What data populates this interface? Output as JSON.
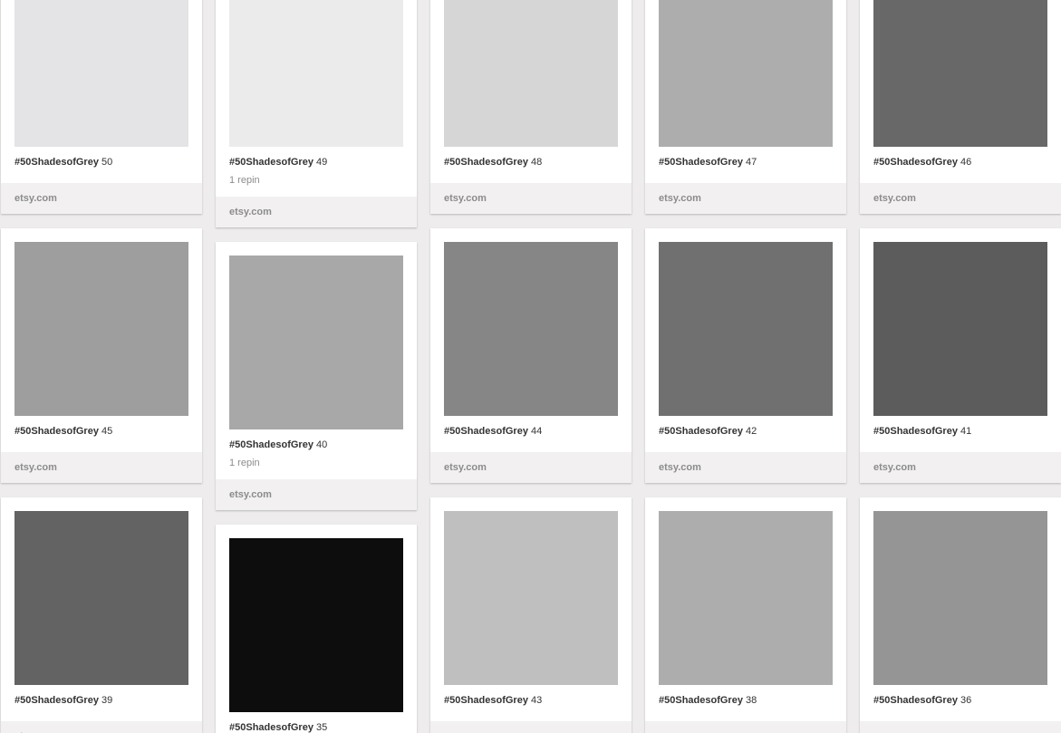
{
  "board": {
    "columns": [
      {
        "pins": [
          {
            "tag": "#50ShadesofGrey",
            "number": "50",
            "repins": "",
            "source": "etsy.com",
            "color": "#e4e4e6"
          },
          {
            "tag": "#50ShadesofGrey",
            "number": "45",
            "repins": "",
            "source": "etsy.com",
            "color": "#9e9e9e"
          },
          {
            "tag": "#50ShadesofGrey",
            "number": "39",
            "repins": "",
            "source": "etsy.com",
            "color": "#636363"
          }
        ]
      },
      {
        "pins": [
          {
            "tag": "#50ShadesofGrey",
            "number": "49",
            "repins": "1 repin",
            "source": "etsy.com",
            "color": "#ebebeb"
          },
          {
            "tag": "#50ShadesofGrey",
            "number": "40",
            "repins": "1 repin",
            "source": "etsy.com",
            "color": "#a8a8a8"
          },
          {
            "tag": "#50ShadesofGrey",
            "number": "35",
            "repins": "",
            "source": "",
            "color": "#0d0d0d"
          }
        ]
      },
      {
        "pins": [
          {
            "tag": "#50ShadesofGrey",
            "number": "48",
            "repins": "",
            "source": "etsy.com",
            "color": "#d6d6d6"
          },
          {
            "tag": "#50ShadesofGrey",
            "number": "44",
            "repins": "",
            "source": "etsy.com",
            "color": "#868686"
          },
          {
            "tag": "#50ShadesofGrey",
            "number": "43",
            "repins": "",
            "source": "",
            "color": "#bfbfbf"
          }
        ]
      },
      {
        "pins": [
          {
            "tag": "#50ShadesofGrey",
            "number": "47",
            "repins": "",
            "source": "etsy.com",
            "color": "#adadad"
          },
          {
            "tag": "#50ShadesofGrey",
            "number": "42",
            "repins": "",
            "source": "etsy.com",
            "color": "#707070"
          },
          {
            "tag": "#50ShadesofGrey",
            "number": "38",
            "repins": "",
            "source": "",
            "color": "#adadad"
          }
        ]
      },
      {
        "pins": [
          {
            "tag": "#50ShadesofGrey",
            "number": "46",
            "repins": "",
            "source": "etsy.com",
            "color": "#686868"
          },
          {
            "tag": "#50ShadesofGrey",
            "number": "41",
            "repins": "",
            "source": "etsy.com",
            "color": "#5c5c5c"
          },
          {
            "tag": "#50ShadesofGrey",
            "number": "36",
            "repins": "",
            "source": "",
            "color": "#959595"
          }
        ]
      }
    ]
  }
}
